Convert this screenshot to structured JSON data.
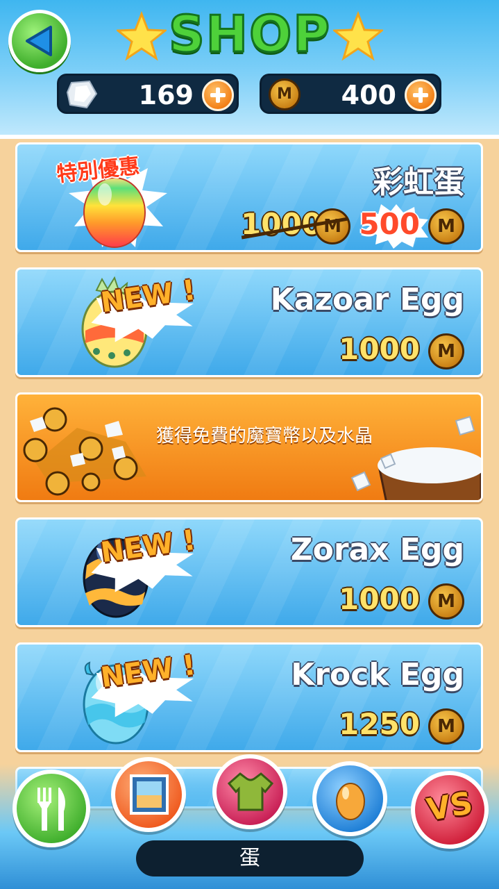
{
  "header": {
    "title": "SHOP",
    "gems": {
      "value": "169",
      "icon": "crystal-icon"
    },
    "coins": {
      "value": "400",
      "icon": "m-coin-icon"
    }
  },
  "coin_symbol": "M",
  "items": [
    {
      "name": "彩虹蛋",
      "special_badge": "特別優惠",
      "original_price": "1000",
      "price": "500",
      "egg_colors": [
        "#ff4a4a",
        "#ffd23a",
        "#5ce07a"
      ]
    },
    {
      "name": "Kazoar Egg",
      "badge": "NEW !",
      "price": "1000",
      "egg_colors": [
        "#ffe27a",
        "#ff6a3a",
        "#79d3a1"
      ]
    },
    {
      "name": "Zorax Egg",
      "badge": "NEW !",
      "price": "1000",
      "egg_colors": [
        "#1a2a4a",
        "#ffb83a",
        "#5a8ad6"
      ]
    },
    {
      "name": "Krock Egg",
      "badge": "NEW !",
      "price": "1250",
      "egg_colors": [
        "#a8f0ff",
        "#3ac0e8",
        "#ffffff"
      ]
    }
  ],
  "promo": {
    "text": "獲得免費的魔寶幣以及水晶"
  },
  "nav": {
    "label": "蛋",
    "buttons": [
      {
        "icon": "fork-knife-icon",
        "color": "#5ccf3a"
      },
      {
        "icon": "frame-icon",
        "color": "#ff6a2a"
      },
      {
        "icon": "shirt-icon",
        "color": "#d8306a"
      },
      {
        "icon": "egg-icon",
        "color": "#2f8fe6"
      },
      {
        "icon": "vs-icon",
        "color": "#e82a4a"
      }
    ],
    "vs_text": "VS"
  }
}
